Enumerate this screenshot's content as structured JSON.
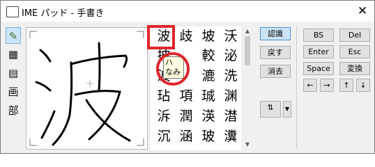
{
  "window": {
    "title": "IME パッド - 手書き",
    "close_label": "✕"
  },
  "left_tools": [
    "✎",
    "▦",
    "▤",
    "画",
    "部"
  ],
  "candidates": [
    [
      "波",
      "歧",
      "坡",
      "沃"
    ],
    [
      "披",
      "",
      "較",
      "泌"
    ],
    [
      "波",
      "",
      "漉",
      "洗"
    ],
    [
      "玷",
      "項",
      "珹",
      "渊"
    ],
    [
      "泝",
      "潤",
      "渶",
      "澘"
    ],
    [
      "沉",
      "涵",
      "玻",
      "瀵"
    ]
  ],
  "tooltip": {
    "line1": "ハ",
    "line2": "なみ"
  },
  "side_buttons": {
    "recognize": "認識",
    "back": "戻す",
    "clear": "消去"
  },
  "key_buttons": {
    "bs": "BS",
    "del": "Del",
    "enter": "Enter",
    "esc": "Esc",
    "space": "Space",
    "convert": "変換"
  },
  "arrows": {
    "left": "←",
    "right": "→",
    "up": "↑",
    "down": "↓"
  },
  "colors": {
    "highlight": "#e0262c",
    "accent": "#4a8cd6"
  }
}
